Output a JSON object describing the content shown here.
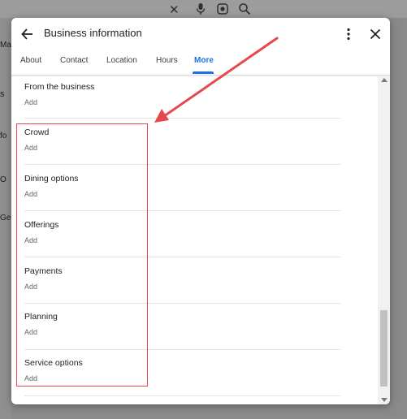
{
  "background": {
    "fragments": [
      "Map",
      "s",
      "fo",
      "O",
      "Ge"
    ]
  },
  "dialog": {
    "title": "Business information",
    "tabs": [
      {
        "label": "About",
        "active": false
      },
      {
        "label": "Contact",
        "active": false
      },
      {
        "label": "Location",
        "active": false
      },
      {
        "label": "Hours",
        "active": false
      },
      {
        "label": "More",
        "active": true
      }
    ],
    "sections": [
      {
        "label": "From the business",
        "action": "Add"
      },
      {
        "label": "Crowd",
        "action": "Add"
      },
      {
        "label": "Dining options",
        "action": "Add"
      },
      {
        "label": "Offerings",
        "action": "Add"
      },
      {
        "label": "Payments",
        "action": "Add"
      },
      {
        "label": "Planning",
        "action": "Add"
      },
      {
        "label": "Service options",
        "action": "Add"
      }
    ]
  },
  "colors": {
    "accent": "#1a73e8",
    "annotation": "#e5484d"
  },
  "icons": {
    "back": "arrow-left-icon",
    "more": "kebab-menu-icon",
    "close": "close-icon",
    "mic": "microphone-icon",
    "lens": "lens-icon",
    "search": "search-icon"
  }
}
